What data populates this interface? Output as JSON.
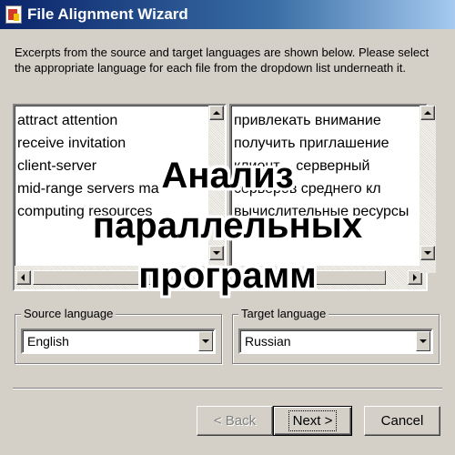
{
  "window": {
    "title": "File Alignment Wizard",
    "title_bar_color": "#0a246a",
    "app_icon": "wizard-app-icon"
  },
  "instructions": "Excerpts from the source and target languages are shown below. Please select the appropriate language for each file from the dropdown list underneath it.",
  "source_list": {
    "items": [
      "attract attention",
      "receive invitation",
      "client-server",
      "mid-range servers ma",
      "computing resources"
    ]
  },
  "target_list": {
    "items": [
      "привлекать внимание",
      "получить приглашение",
      "клиент – серверный",
      "серверов среднего кл",
      "вычислительные ресурсы"
    ]
  },
  "source_language": {
    "legend": "Source language",
    "value": "English"
  },
  "target_language": {
    "legend": "Target language",
    "value": "Russian"
  },
  "buttons": {
    "back": "< Back",
    "next": "Next >",
    "cancel": "Cancel"
  },
  "overlay": {
    "lines": [
      "Анализ",
      "параллельных",
      "программ"
    ]
  },
  "icons": {
    "scroll_up": "arrow-up-icon",
    "scroll_down": "arrow-down-icon",
    "scroll_left": "arrow-left-icon",
    "scroll_right": "arrow-right-icon",
    "dropdown": "chevron-down-icon"
  }
}
